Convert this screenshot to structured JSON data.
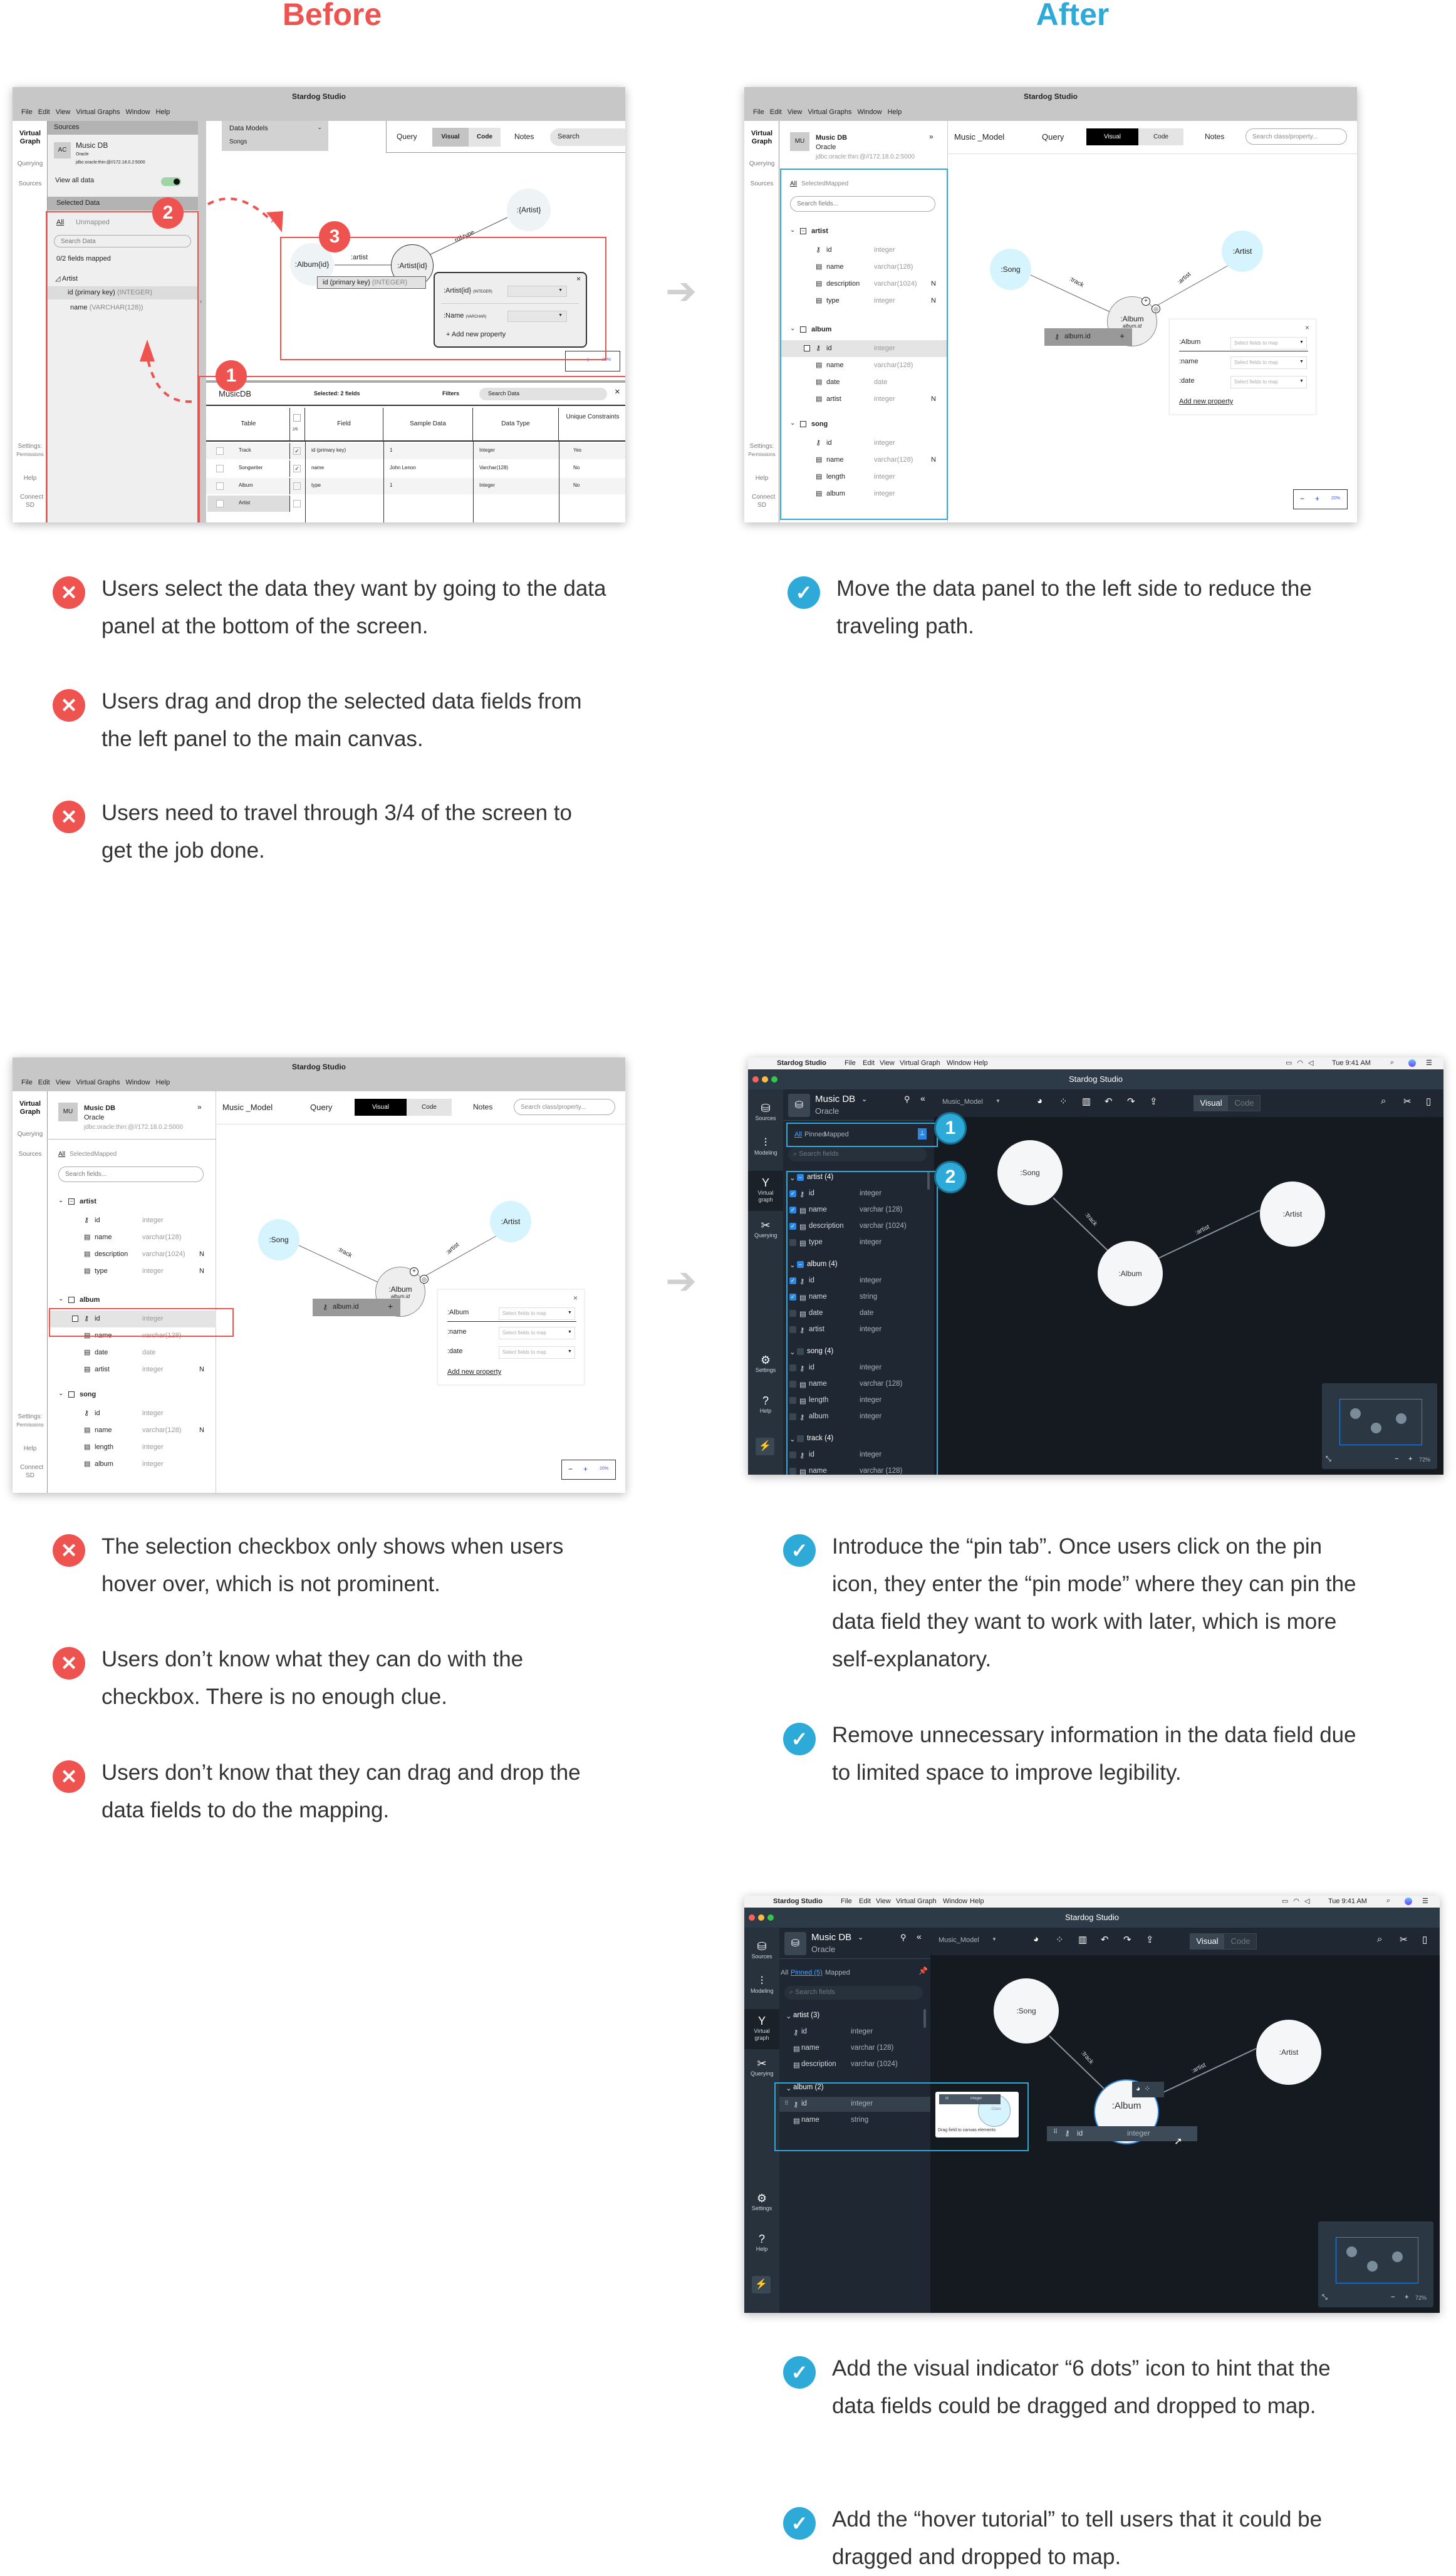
{
  "headings": {
    "before": "Before",
    "after": "After"
  },
  "colors": {
    "before_red": "#ef5350",
    "after_blue": "#2eaad8",
    "dark_canvas": "#141a20",
    "dark_panel": "#1f2832",
    "wire_node": "#d6f4fd"
  },
  "screen1": {
    "title": "Stardog Studio",
    "menu": [
      "File",
      "Edit",
      "View",
      "Virtual Graphs",
      "Window",
      "Help"
    ],
    "nav": {
      "virtual_graph": "Virtual Graph",
      "querying": "Querying",
      "sources": "Sources",
      "settings": "Settings:",
      "permissions": "Permissions",
      "help": "Help",
      "connect": "Connect SD"
    },
    "sources_header": "Sources",
    "db": {
      "avatar": "AC",
      "name": "Music DB",
      "type": "Oracle",
      "url": "jdbc:oracle:thin:@//172.18.0.2:5000"
    },
    "view_all": "View all data",
    "view_all_on": true,
    "selected_header": "Selected Data",
    "tabs": [
      "All",
      "Unmapped"
    ],
    "search_placeholder": "Search Data",
    "fields_mapped": "0/2 fields mapped",
    "tree": {
      "group": "Artist",
      "field1": "id (primary key)",
      "field1_type": "(INTEGER)",
      "field2": "name",
      "field2_type": "(VARCHAR(128))"
    },
    "data_models": {
      "label": "Data Models",
      "item": "Songs"
    },
    "toolbar": {
      "query": "Query",
      "visual": "Visual",
      "code": "Code",
      "notes": "Notes",
      "search": "Search"
    },
    "canvas": {
      "album": ":Album{id}",
      "artist_id": ":Artist{id}",
      "artist_class": ":{Artist}",
      "edge_artist": ":artist",
      "edge_type": "rdf:type",
      "drag_field": "id (primary key)",
      "drag_type": "(INTEGER)"
    },
    "popup": {
      "prop1": ":Artist{id}",
      "prop1_type": "(INTEGER)",
      "prop2": ":Name",
      "prop2_type": "(VARCHAR)",
      "add": "+ Add new property"
    },
    "zoom": "20%",
    "bottom": {
      "db": "MusicDB",
      "selected": "Selected: 2 fields",
      "filters": "Filters",
      "search": "Search Data",
      "count": "2/5",
      "headers": [
        "Table",
        "Field",
        "Sample Data",
        "Data Type",
        "Unique Constraints"
      ],
      "tables": [
        "Track",
        "Songwriter",
        "Album",
        "Artist"
      ],
      "rows": [
        {
          "checked": true,
          "field": "id (primary key)",
          "sample": "1",
          "type": "Integer",
          "unique": "Yes"
        },
        {
          "checked": true,
          "field": "name",
          "sample": "John Lenon",
          "type": "Varchar(128)",
          "unique": "No"
        },
        {
          "checked": false,
          "field": "type",
          "sample": "1",
          "type": "Integer",
          "unique": "No"
        }
      ]
    },
    "badges": [
      "1",
      "2",
      "3"
    ]
  },
  "wire": {
    "title": "Stardog Studio",
    "menu": [
      "File",
      "Edit",
      "View",
      "Virtual Graphs",
      "Window",
      "Help"
    ],
    "nav": {
      "virtual_graph": "Virtual Graph",
      "querying": "Querying",
      "sources": "Sources",
      "settings": "Settings:",
      "permissions": "Permissions",
      "help": "Help",
      "connect": "Connect SD"
    },
    "db": {
      "avatar": "MU",
      "name": "Music DB",
      "type": "Oracle",
      "url": "jdbc:oracle:thin:@//172.18.0.2:5000"
    },
    "tabs": [
      "All",
      "Selected",
      "Mapped"
    ],
    "search_placeholder": "Search fields...",
    "groups": [
      {
        "name": "artist",
        "fields": [
          {
            "icon": "key",
            "name": "id",
            "type": "integer",
            "n": ""
          },
          {
            "icon": "column",
            "name": "name",
            "type": "varchar(128)",
            "n": ""
          },
          {
            "icon": "column",
            "name": "description",
            "type": "varchar(1024)",
            "n": "N"
          },
          {
            "icon": "column",
            "name": "type",
            "type": "integer",
            "n": "N"
          }
        ]
      },
      {
        "name": "album",
        "fields": [
          {
            "icon": "key",
            "name": "id",
            "type": "integer",
            "n": ""
          },
          {
            "icon": "column",
            "name": "name",
            "type": "varchar(128)",
            "n": ""
          },
          {
            "icon": "column",
            "name": "date",
            "type": "date",
            "n": ""
          },
          {
            "icon": "column",
            "name": "artist",
            "type": "integer",
            "n": "N"
          }
        ]
      },
      {
        "name": "song",
        "fields": [
          {
            "icon": "key",
            "name": "id",
            "type": "integer",
            "n": ""
          },
          {
            "icon": "column",
            "name": "name",
            "type": "varchar(128)",
            "n": "N"
          },
          {
            "icon": "column",
            "name": "length",
            "type": "integer",
            "n": ""
          },
          {
            "icon": "column",
            "name": "album",
            "type": "integer",
            "n": ""
          }
        ]
      }
    ],
    "toolbar": {
      "model": "Music _Model",
      "query": "Query",
      "visual": "Visual",
      "code": "Code",
      "notes": "Notes",
      "search_placeholder": "Search class/property..."
    },
    "canvas": {
      "song": ":Song",
      "artist": ":Artist",
      "album": ":Album",
      "album_sub": "album.id",
      "edge_track": ":track",
      "edge_artist": ":artist",
      "drag_field": "album.id"
    },
    "popup": {
      "rows": [
        ":Album",
        ":name",
        ":date"
      ],
      "select_placeholder": "Select fields to map",
      "add": "Add new property"
    },
    "zoom": "20%"
  },
  "dark": {
    "mac_menu": [
      "Stardog Studio",
      "File",
      "Edit",
      "View",
      "Virtual Graph",
      "Window",
      "Help"
    ],
    "clock": "Tue 9:41 AM",
    "title": "Stardog Studio",
    "nav": [
      "Sources",
      "Modeling",
      "Virtual graph",
      "Querying",
      "Settings",
      "Help"
    ],
    "db": {
      "name": "Music DB",
      "type": "Oracle"
    },
    "model": "Music_Model",
    "visual": "Visual",
    "code": "Code",
    "search_placeholder": "Search fields",
    "canvas": {
      "song": ":Song",
      "artist": ":Artist",
      "album": ":Album",
      "edge_track": ":track",
      "edge_artist": ":artist"
    },
    "zoom": "72%"
  },
  "screen4": {
    "tabs": [
      "All",
      "Pinned",
      "Mapped"
    ],
    "groups": [
      {
        "name": "artist (4)",
        "state": "partial",
        "fields": [
          {
            "icon": "key",
            "name": "id",
            "type": "integer",
            "checked": true
          },
          {
            "icon": "column",
            "name": "name",
            "type": "varchar (128)",
            "checked": true
          },
          {
            "icon": "column",
            "name": "description",
            "type": "varchar (1024)",
            "checked": true
          },
          {
            "icon": "column",
            "name": "type",
            "type": "integer",
            "checked": false
          }
        ]
      },
      {
        "name": "album (4)",
        "state": "partial",
        "fields": [
          {
            "icon": "key",
            "name": "id",
            "type": "integer",
            "checked": true
          },
          {
            "icon": "column",
            "name": "name",
            "type": "string",
            "checked": true
          },
          {
            "icon": "column",
            "name": "date",
            "type": "date",
            "checked": false
          },
          {
            "icon": "fkey",
            "name": "artist",
            "type": "integer",
            "checked": false
          }
        ]
      },
      {
        "name": "song (4)",
        "state": "none",
        "fields": [
          {
            "icon": "key",
            "name": "id",
            "type": "integer",
            "checked": false
          },
          {
            "icon": "column",
            "name": "name",
            "type": "varchar (128)",
            "checked": false
          },
          {
            "icon": "column",
            "name": "length",
            "type": "integer",
            "checked": false
          },
          {
            "icon": "fkey",
            "name": "album",
            "type": "integer",
            "checked": false
          }
        ]
      },
      {
        "name": "track (4)",
        "state": "none",
        "fields": [
          {
            "icon": "key",
            "name": "id",
            "type": "integer",
            "checked": false
          },
          {
            "icon": "column",
            "name": "name",
            "type": "varchar (128)",
            "checked": false
          }
        ]
      }
    ],
    "badges": [
      "1",
      "2"
    ]
  },
  "screen5": {
    "tabs": [
      "All",
      "Pinned (5)",
      "Mapped"
    ],
    "groups": [
      {
        "name": "artist (3)",
        "fields": [
          {
            "icon": "key",
            "name": "id",
            "type": "integer"
          },
          {
            "icon": "column",
            "name": "name",
            "type": "varchar (128)"
          },
          {
            "icon": "column",
            "name": "description",
            "type": "varchar (1024)"
          }
        ]
      },
      {
        "name": "album (2)",
        "fields": [
          {
            "icon": "key",
            "name": "id",
            "type": "integer"
          },
          {
            "icon": "column",
            "name": "name",
            "type": "string"
          }
        ]
      }
    ],
    "tooltip": {
      "field": "id",
      "type": "integer",
      "class": ":Class",
      "text": "Drag field to canvas elements"
    },
    "drag": {
      "field": "id",
      "type": "integer"
    }
  },
  "notes": {
    "before_1": [
      "Users select the data they want by going to the data panel at the bottom of the screen.",
      "Users drag and drop the selected data fields from the left panel to the main canvas.",
      "Users need to travel through 3/4 of the screen to get the job done."
    ],
    "after_1": [
      "Move the data panel to the left side to reduce the traveling path."
    ],
    "before_2": [
      "The selection checkbox only shows when users hover over, which is not prominent.",
      "Users don’t know what they can do with the checkbox. There is no enough clue.",
      "Users don’t know that they can drag and drop the data fields to do the mapping."
    ],
    "after_2": [
      "Introduce the “pin tab”. Once users click on the pin icon, they enter the “pin mode” where they can pin the data field they want to work with later, which is more self-explanatory.",
      "Remove unnecessary information in the data field due to limited space to improve legibility."
    ],
    "after_3": [
      "Add the visual indicator “6 dots” icon to hint that the data fields could be dragged and dropped to map.",
      "Add the “hover tutorial” to tell users that it could be dragged and dropped to map."
    ]
  }
}
